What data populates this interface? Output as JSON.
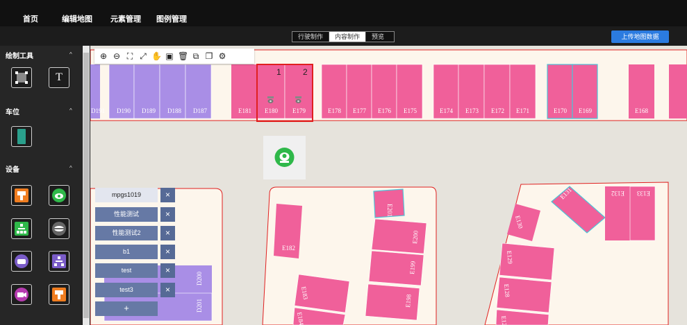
{
  "nav": {
    "items": [
      "首页",
      "编辑地图",
      "元素管理",
      "图例管理"
    ]
  },
  "modes": {
    "tabs": [
      "行驶制作",
      "内容制作",
      "预览"
    ],
    "active": 1
  },
  "upload_label": "上传地图数据",
  "sidebar": {
    "sections": [
      {
        "title": "绘制工具",
        "chevron": "^"
      },
      {
        "title": "车位",
        "chevron": "^"
      },
      {
        "title": "设备",
        "chevron": "^"
      }
    ]
  },
  "toolbar": {
    "icons": [
      "zoom-in-icon",
      "zoom-out-icon",
      "fit-icon",
      "fullscreen-icon",
      "hand-icon",
      "save-icon",
      "delete-icon",
      "copy-icon",
      "paste-icon",
      "settings-icon"
    ]
  },
  "map": {
    "top_row": [
      "D191",
      "D190",
      "D189",
      "D188",
      "D187",
      "E181",
      "E180",
      "E179",
      "E178",
      "E177",
      "E176",
      "E175",
      "E174",
      "E173",
      "E172",
      "E171",
      "E170",
      "E169",
      "E168"
    ],
    "selection_numbers": [
      "1",
      "2"
    ],
    "other_labels": [
      "E182",
      "E201",
      "E200",
      "E199",
      "E198",
      "E183",
      "E184",
      "E130",
      "E129",
      "E128",
      "E127",
      "E131",
      "E132",
      "E133",
      "D200",
      "D201"
    ]
  },
  "floors": {
    "items": [
      "mpgs1019",
      "性能测试",
      "性能测试2",
      "b1",
      "test",
      "test3"
    ],
    "active": 0,
    "remove_label": "×",
    "add_label": "+"
  },
  "colors": {
    "pink": "#f0609a",
    "purple": "#a98ee6",
    "selection": "#e02020",
    "blue_highlight": "#4ec3d8",
    "primary": "#2b7be0"
  }
}
